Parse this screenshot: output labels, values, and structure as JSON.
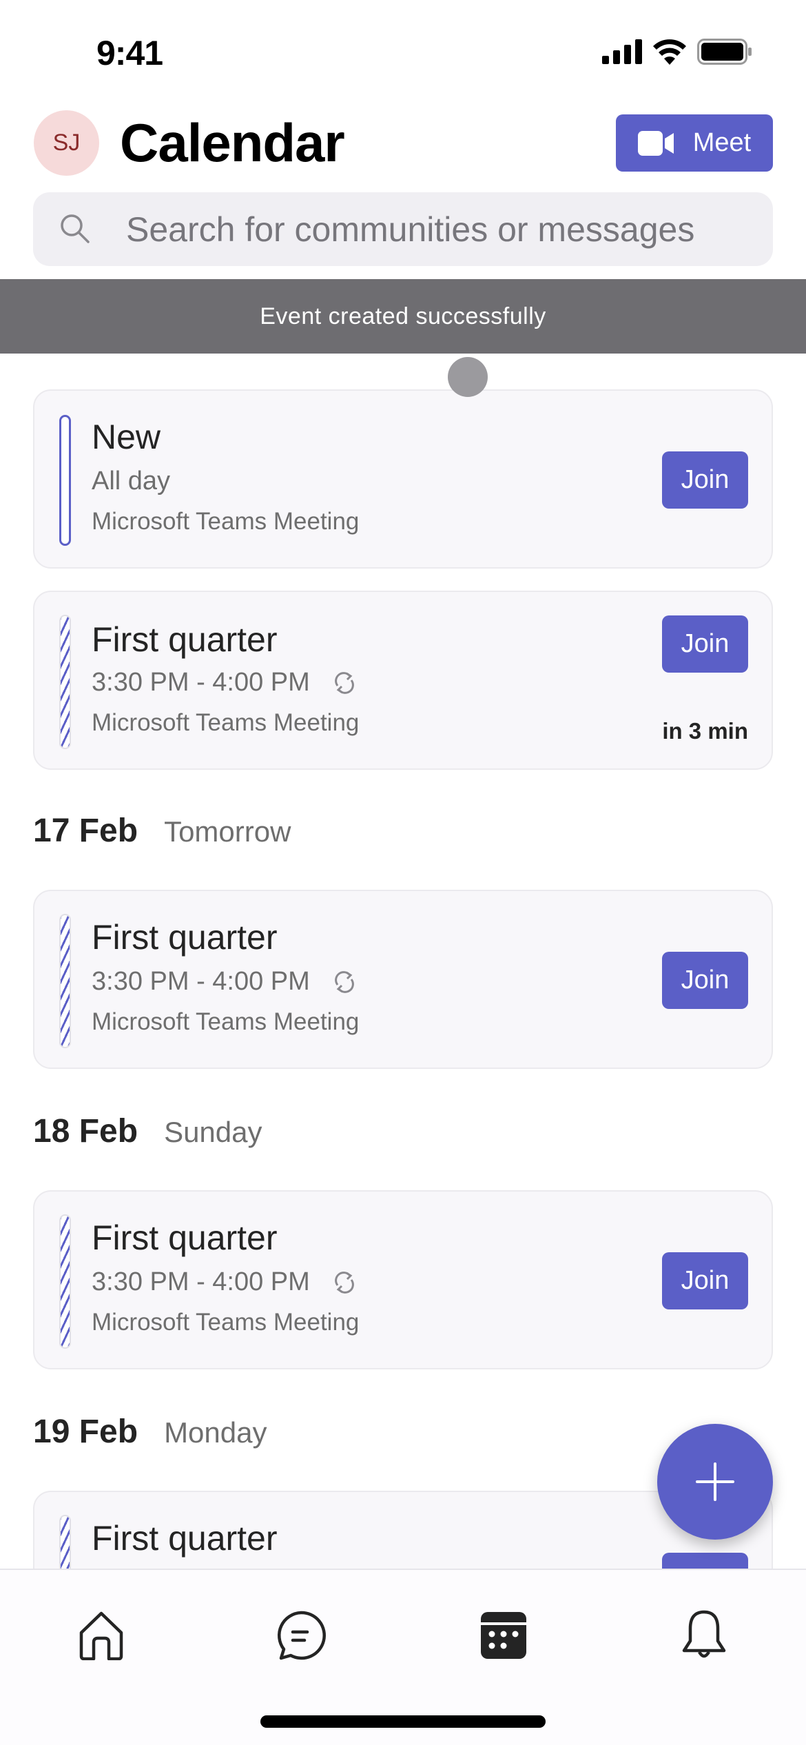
{
  "status_bar": {
    "time": "9:41"
  },
  "header": {
    "avatar_initials": "SJ",
    "title": "Calendar",
    "meet_label": "Meet"
  },
  "search": {
    "placeholder": "Search for communities or messages"
  },
  "toast": {
    "message": "Event created successfully"
  },
  "colors": {
    "accent": "#5b5fc7",
    "toast_bg": "#6e6d71",
    "card_bg": "#f8f7fa"
  },
  "events_today": [
    {
      "title": "New",
      "time": "All day",
      "recurring": false,
      "location": "Microsoft Teams Meeting",
      "join_label": "Join",
      "eta": ""
    },
    {
      "title": "First quarter",
      "time": "3:30 PM - 4:00 PM",
      "recurring": true,
      "location": "Microsoft Teams Meeting",
      "join_label": "Join",
      "eta": "in 3 min"
    }
  ],
  "days": [
    {
      "date": "17 Feb",
      "weekday": "Tomorrow",
      "events": [
        {
          "title": "First quarter",
          "time": "3:30 PM - 4:00 PM",
          "recurring": true,
          "location": "Microsoft Teams Meeting",
          "join_label": "Join"
        }
      ]
    },
    {
      "date": "18 Feb",
      "weekday": "Sunday",
      "events": [
        {
          "title": "First quarter",
          "time": "3:30 PM - 4:00 PM",
          "recurring": true,
          "location": "Microsoft Teams Meeting",
          "join_label": "Join"
        }
      ]
    },
    {
      "date": "19 Feb",
      "weekday": "Monday",
      "events": [
        {
          "title": "First quarter",
          "join_label": "Join"
        }
      ]
    }
  ],
  "tabbar": {
    "items": [
      {
        "name": "home",
        "icon": "home-icon",
        "active": false
      },
      {
        "name": "chat",
        "icon": "chat-icon",
        "active": false
      },
      {
        "name": "calendar",
        "icon": "calendar-icon",
        "active": true
      },
      {
        "name": "activity",
        "icon": "bell-icon",
        "active": false
      }
    ]
  }
}
